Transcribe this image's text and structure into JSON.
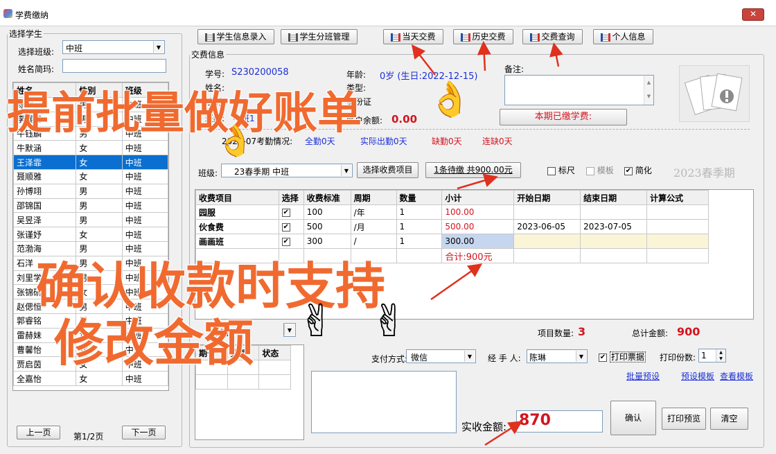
{
  "window": {
    "title": "学费缴纳",
    "close": "✕"
  },
  "left": {
    "legend": "选择学生",
    "class_label": "选择班级:",
    "class_value": "中班",
    "name_label": "姓名简玛:",
    "name_value": "",
    "headers": [
      "姓名",
      "性别",
      "班级"
    ],
    "rows": [
      [
        "陈啊",
        "男",
        "中班"
      ],
      [
        "李展亮",
        "男",
        "中班"
      ],
      [
        "牛钰麟",
        "男",
        "中班"
      ],
      [
        "牛默涵",
        "女",
        "中班"
      ],
      [
        "王泽霏",
        "女",
        "中班"
      ],
      [
        "聂顺雅",
        "女",
        "中班"
      ],
      [
        "孙博翊",
        "男",
        "中班"
      ],
      [
        "邵锦国",
        "男",
        "中班"
      ],
      [
        "吴昱泽",
        "男",
        "中班"
      ],
      [
        "张谨妤",
        "女",
        "中班"
      ],
      [
        "范渤海",
        "男",
        "中班"
      ],
      [
        "石洋",
        "男",
        "中班"
      ],
      [
        "刘里学",
        "男",
        "中班"
      ],
      [
        "张锦研",
        "女",
        "中班"
      ],
      [
        "赵偲恒",
        "男",
        "中班"
      ],
      [
        "郭睿铭",
        "男",
        "中班"
      ],
      [
        "雷赫妹",
        "女",
        "中班"
      ],
      [
        "曹馨怡",
        "女",
        "中班"
      ],
      [
        "贾启茵",
        "女",
        "中班"
      ],
      [
        "全嘉怡",
        "女",
        "中班"
      ]
    ],
    "selected_row": 4,
    "prev": "上一页",
    "page": "第1/2页",
    "next": "下一页"
  },
  "toolbar": {
    "info_entry": "学生信息录入",
    "class_mgmt": "学生分班管理",
    "today": "当天交费",
    "history": "历史交费",
    "query": "交费查询",
    "personal": "个人信息"
  },
  "info": {
    "legend": "交费信息",
    "sid_label": "学号:",
    "sid_value": "S230200058",
    "age_label": "年龄:",
    "age_value": "0岁 (生日:2022-12-15)",
    "name_label": "姓名:",
    "type_label": "类型:",
    "gender_label": "性别:",
    "idcard_label": "身份证",
    "class_label": "班级:",
    "class_value": "中班1",
    "balance_label": "账户余额:",
    "balance_value": "0.00",
    "remark_label": "备注:",
    "paid_button": "本期已缴学费:",
    "attendance_label": "2023-07考勤情况:",
    "full": "全勤0天",
    "actual": "实际出勤0天",
    "absent": "缺勤0天",
    "consecutive": "连缺0天"
  },
  "fee": {
    "class_label": "班级:",
    "term_value": "23春季期 中班",
    "select_button": "选择收费项目",
    "pending": "1条待缴 共900.00元",
    "ruler": "标尺",
    "template": "模板",
    "simplify": "简化",
    "term_label": "2023春季期",
    "headers": [
      "收费项目",
      "选择",
      "收费标准",
      "周期",
      "数量",
      "小计",
      "开始日期",
      "结束日期",
      "计算公式"
    ],
    "rows": [
      {
        "item": "园服",
        "std": "100",
        "period": "/年",
        "qty": "1",
        "sub": "100.00",
        "start": "",
        "end": ""
      },
      {
        "item": "伙食费",
        "std": "500",
        "period": "/月",
        "qty": "1",
        "sub": "500.00",
        "start": "2023-06-05",
        "end": "2023-07-05"
      },
      {
        "item": "画画班",
        "std": "300",
        "period": "/",
        "qty": "1",
        "sub": "300.00",
        "start": "",
        "end": ""
      }
    ],
    "total_row": "合计:900元",
    "count_label": "项目数量:",
    "count_value": "3",
    "total_label": "总计金额:",
    "total_value": "900"
  },
  "bottom": {
    "period_label": "分期",
    "sub_headers": [
      "期号",
      "金额",
      "状态"
    ],
    "pay_label": "支付方式:",
    "pay_value": "微信",
    "handler_label": "经 手 人:",
    "handler_value": "陈琳",
    "print_receipt": "打印票据",
    "copies_label": "打印份数:",
    "copies_value": "1",
    "batch": "批量预设",
    "preset": "预设模板",
    "view": "查看模板",
    "actual_label": "实收金额:",
    "actual_value": "870",
    "confirm": "确认",
    "preview": "打印预览",
    "clear": "清空"
  },
  "overlay": {
    "line1": "提前批量做好账单",
    "line2": "确认收款时支持",
    "line3": "修改金额",
    "ok": "👌",
    "victory": "✌"
  },
  "colors": {
    "accent": "#0a6fd0",
    "red": "#d4141e",
    "blue": "#1d2fd6",
    "overlay": "#f06a30"
  }
}
